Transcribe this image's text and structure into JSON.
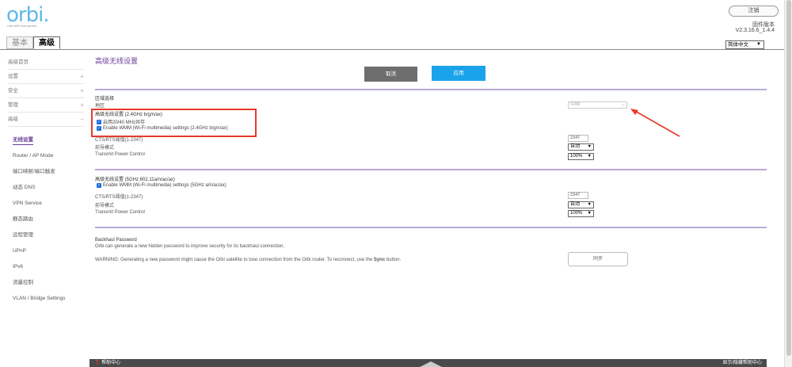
{
  "brand": {
    "logo": "orbi.",
    "tagline": "Orbi WiFi Everywhere"
  },
  "header": {
    "logout_label": "注销",
    "fw_label": "固件版本",
    "fw_version": "V2.3.16.6_1.4.4"
  },
  "tabs": [
    {
      "label": "基本"
    },
    {
      "label": "高级",
      "active": true
    }
  ],
  "language": {
    "selected": "简体中文"
  },
  "sidebar": {
    "items": [
      {
        "label": "高级首页",
        "sign": ""
      },
      {
        "label": "设置",
        "sign": "+"
      },
      {
        "label": "安全",
        "sign": "+"
      },
      {
        "label": "管理",
        "sign": "+"
      },
      {
        "label": "高级",
        "sign": "−"
      }
    ],
    "subitems": [
      {
        "label": "无线设置",
        "active": true
      },
      {
        "label": "Router / AP Mode"
      },
      {
        "label": "端口映射/端口触发"
      },
      {
        "label": "动态 DNS"
      },
      {
        "label": "VPN Service"
      },
      {
        "label": "静态路由"
      },
      {
        "label": "远程管理"
      },
      {
        "label": "UPnP"
      },
      {
        "label": "IPv6"
      },
      {
        "label": "流量控制"
      },
      {
        "label": "VLAN / Bridge Settings"
      }
    ]
  },
  "main": {
    "title": "高级无线设置",
    "cancel_label": "取消",
    "apply_label": "应用",
    "region": {
      "section": "区域选择",
      "label": "地区",
      "value": "中国"
    },
    "band24": {
      "heading": "高级无线设置 (2.4GHz b/g/n/ax)",
      "coexist_label": "启用20/40 MHz共存",
      "wmm_label": "Enable WMM (Wi-Fi multimedia) settings (2.4GHz b/g/n/ax)",
      "rts_label": "CTS/RTS阈值(1-2347)",
      "rts_value": "2347",
      "preamble_label": "前导模式",
      "preamble_value": "自动",
      "power_label": "Transmit Power Control",
      "power_value": "100%"
    },
    "band5": {
      "heading": "高级无线设置 (5GHz 802.11a/n/ac/ax)",
      "wmm_label": "Enable WMM (Wi-Fi multimedia) settings (5GHz a/n/ac/ax)",
      "rts_label": "CTS/RTS阈值(1-2347)",
      "rts_value": "2347",
      "preamble_label": "前导模式",
      "preamble_value": "自动",
      "power_label": "Transmit Power Control",
      "power_value": "100%"
    },
    "backhaul": {
      "heading": "Backhaul Password",
      "desc": "Orbi can generate a new hidden password to improve security for its backhaul connection.",
      "warning_prefix": "WARNING: Generating a new password might cause the Orbi satellite to lose connection from the Orbi router. To reconnect, use the ",
      "warning_bold": "Sync",
      "warning_suffix": " button.",
      "sync_label": "同步"
    }
  },
  "footer": {
    "left": "帮助中心",
    "right": "显示/隐藏帮助中心"
  },
  "colors": {
    "accent": "#6a3d9a",
    "apply": "#1aa3ea",
    "highlight": "#e8392a"
  }
}
